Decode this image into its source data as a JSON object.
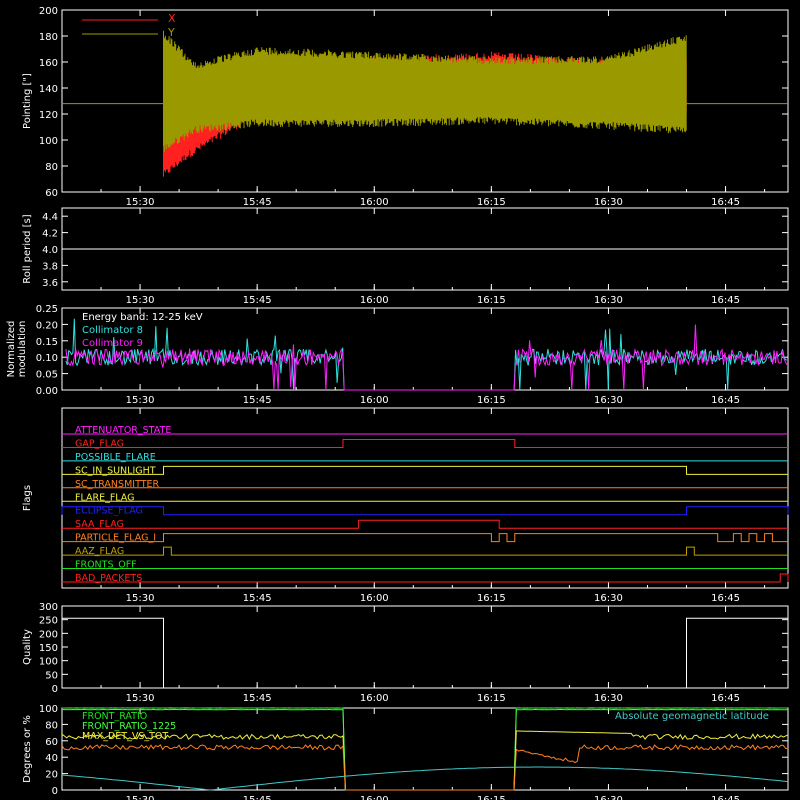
{
  "colors": {
    "background": "#000000",
    "axes": "#ffffff",
    "red": "#ff2020",
    "olive": "#9a9a00",
    "cyan": "#30e0e0",
    "magenta": "#ff20ff",
    "white": "#ffffff",
    "yellow": "#f0f040",
    "orange": "#ff8020",
    "blue": "#2020ff",
    "green": "#20e020",
    "brightgreen": "#40ff40",
    "goldenrod": "#c0a000",
    "lightcyan": "#40c8c8"
  },
  "chart_data": [
    {
      "type": "line",
      "panel": "pointing",
      "ylabel": "Pointing [\"]",
      "ylim": [
        60,
        200
      ],
      "yticks": [
        "60",
        "80",
        "100",
        "120",
        "140",
        "160",
        "180",
        "200"
      ],
      "xticks": [
        "15:30",
        "15:45",
        "16:00",
        "16:15",
        "16:30",
        "16:45"
      ],
      "x_minutes_range": [
        "15:20",
        "16:53"
      ],
      "legend_position": "top-left",
      "series": [
        {
          "name": "X",
          "color": "red",
          "baseline_before": null,
          "data_start": "15:33",
          "data_end": "16:40",
          "envelope": [
            [
              "15:33",
              70,
              175
            ],
            [
              "15:36",
              85,
              155
            ],
            [
              "15:45",
              118,
              160
            ],
            [
              "16:00",
              118,
              164
            ],
            [
              "16:15",
              120,
              168
            ],
            [
              "16:30",
              120,
              162
            ],
            [
              "16:40",
              118,
              163
            ]
          ]
        },
        {
          "name": "Y",
          "color": "olive",
          "baseline": 128,
          "data_start": "15:33",
          "data_end": "16:40",
          "envelope": [
            [
              "15:33",
              90,
              185
            ],
            [
              "15:37",
              105,
              160
            ],
            [
              "15:45",
              110,
              172
            ],
            [
              "16:00",
              110,
              168
            ],
            [
              "16:15",
              112,
              164
            ],
            [
              "16:30",
              108,
              165
            ],
            [
              "16:40",
              104,
              182
            ]
          ]
        }
      ]
    },
    {
      "type": "line",
      "panel": "roll",
      "ylabel": "Roll period [s]",
      "ylim": [
        3.5,
        4.5
      ],
      "yticks": [
        "3.6",
        "3.8",
        "4.0",
        "4.2",
        "4.4"
      ],
      "xticks": [
        "15:30",
        "15:45",
        "16:00",
        "16:15",
        "16:30",
        "16:45"
      ],
      "series": [
        {
          "name": "roll period",
          "color": "white",
          "value": 4.0
        }
      ]
    },
    {
      "type": "line",
      "panel": "modulation",
      "ylabel": "Normalized modulation",
      "ylabel_lines": [
        "Normalized",
        "modulation"
      ],
      "ylim": [
        0.0,
        0.25
      ],
      "yticks": [
        "0.00",
        "0.05",
        "0.10",
        "0.15",
        "0.20",
        "0.25"
      ],
      "xticks": [
        "15:30",
        "15:45",
        "16:00",
        "16:15",
        "16:30",
        "16:45"
      ],
      "annotations": [
        "Energy band: 12-25 keV",
        "Collimator 8",
        "Collimator 9"
      ],
      "series": [
        {
          "name": "Collimator 8",
          "color": "cyan",
          "mean": 0.1,
          "gaps": [
            [
              "15:56",
              "16:18"
            ]
          ]
        },
        {
          "name": "Collimator 9",
          "color": "magenta",
          "mean": 0.1,
          "gaps": [
            [
              "15:56",
              "16:18"
            ]
          ]
        }
      ]
    },
    {
      "type": "line",
      "panel": "flags",
      "ylabel": "Flags",
      "xticks": [
        "15:30",
        "15:45",
        "16:00",
        "16:15",
        "16:30",
        "16:45"
      ],
      "flags": [
        {
          "label": "ATTENUATOR_STATE",
          "color": "magenta",
          "on": []
        },
        {
          "label": "GAP_FLAG",
          "color": "red",
          "on": [
            [
              "15:56",
              "16:18"
            ]
          ]
        },
        {
          "label": "POSSIBLE_FLARE",
          "color": "cyan",
          "on": []
        },
        {
          "label": "SC_IN_SUNLIGHT",
          "color": "yellow",
          "on": [
            [
              "15:33",
              "16:40"
            ]
          ]
        },
        {
          "label": "SC_TRANSMITTER",
          "color": "orange",
          "on": []
        },
        {
          "label": "FLARE_FLAG",
          "color": "yellow",
          "on": []
        },
        {
          "label": "ECLIPSE_FLAG",
          "color": "blue",
          "on": [
            [
              "15:20",
              "15:33"
            ],
            [
              "16:40",
              "16:53"
            ]
          ]
        },
        {
          "label": "SAA_FLAG",
          "color": "red",
          "on": [
            [
              "15:58",
              "16:16"
            ]
          ]
        },
        {
          "label": "PARTICLE_FLAG_I",
          "color": "orange",
          "on": [
            [
              "15:33",
              "16:15"
            ],
            [
              "16:16",
              "16:17"
            ],
            [
              "16:18",
              "16:44"
            ],
            [
              "16:46",
              "16:47"
            ],
            [
              "16:48",
              "16:49"
            ],
            [
              "16:50",
              "16:51"
            ]
          ]
        },
        {
          "label": "AAZ_FLAG",
          "color": "goldenrod",
          "on": [
            [
              "15:33",
              "15:34"
            ],
            [
              "16:40",
              "16:41"
            ]
          ]
        },
        {
          "label": "FRONTS_OFF",
          "color": "green",
          "on": []
        },
        {
          "label": "BAD_PACKETS",
          "color": "red",
          "on": [
            [
              "16:52",
              "16:53"
            ]
          ]
        }
      ]
    },
    {
      "type": "line",
      "panel": "quality",
      "ylabel": "Quality",
      "ylim": [
        0,
        300
      ],
      "yticks": [
        "0",
        "50",
        "100",
        "150",
        "200",
        "250",
        "300"
      ],
      "xticks": [
        "15:30",
        "15:45",
        "16:00",
        "16:15",
        "16:30",
        "16:45"
      ],
      "series": [
        {
          "name": "quality",
          "color": "white",
          "segments": [
            [
              "15:20",
              "15:33",
              255
            ],
            [
              "15:33",
              "16:40",
              0
            ],
            [
              "16:40",
              "16:53",
              255
            ]
          ]
        }
      ]
    },
    {
      "type": "line",
      "panel": "degrees",
      "ylabel": "Degrees or %",
      "ylim": [
        0,
        100
      ],
      "yticks": [
        "0",
        "20",
        "40",
        "60",
        "80",
        "100"
      ],
      "xticks": [
        "15:30",
        "15:45",
        "16:00",
        "16:15",
        "16:30",
        "16:45"
      ],
      "series": [
        {
          "name": "FRONT_RATIO",
          "color": "green",
          "level": 100,
          "gaps": [
            [
              "15:56",
              "16:18"
            ]
          ]
        },
        {
          "name": "FRONT_RATIO_1225",
          "color": "brightgreen",
          "level": 98,
          "gaps": [
            [
              "15:56",
              "16:18"
            ]
          ]
        },
        {
          "name": "MAX_DET_VS_TOT",
          "color": "yellow",
          "level": 65,
          "gaps": [
            [
              "15:56",
              "16:18"
            ]
          ]
        },
        {
          "name": "orange trace",
          "color": "orange",
          "level": 52,
          "gaps": [
            [
              "15:56",
              "16:18"
            ]
          ]
        },
        {
          "name": "Absolute geomagnetic latitude",
          "color": "lightcyan",
          "min": 0,
          "max": 28
        }
      ],
      "annotation": "Absolute geomagnetic latitude"
    }
  ]
}
